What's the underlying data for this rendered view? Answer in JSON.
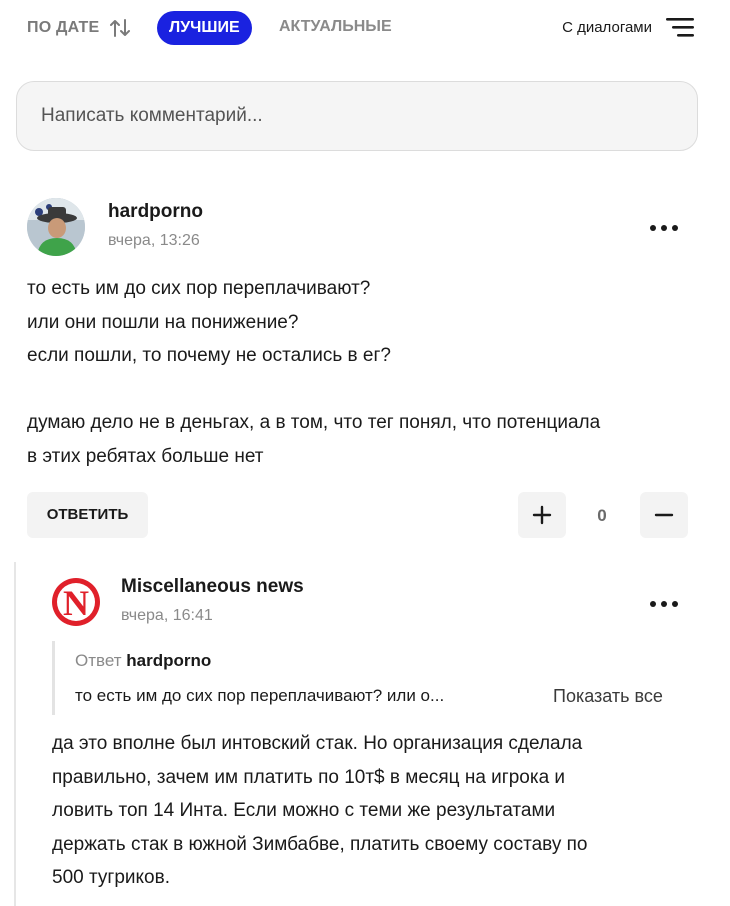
{
  "sortbar": {
    "by_date": "ПО ДАТЕ",
    "best": "ЛУЧШИЕ",
    "actual": "АКТУАЛЬНЫЕ",
    "dialogs": "С диалогами",
    "active_color": "#1a22e0"
  },
  "comment_input": {
    "placeholder": "Написать комментарий..."
  },
  "comment1": {
    "author": "hardporno",
    "time": "вчера, 13:26",
    "lines": [
      "то есть им до сих пор переплачивают?",
      "или они пошли на понижение?",
      "если пошли, то почему не остались в ег?",
      "думаю дело не в деньгах, а в том, что тег понял, что потенциала",
      "в этих ребятах больше нет"
    ],
    "reply_label": "ОТВЕТИТЬ",
    "votes": "0",
    "plus": "+",
    "minus": "−"
  },
  "comment2": {
    "author": "Miscellaneous news",
    "avatar_letter": "N",
    "avatar_color": "#e0202a",
    "time": "вчера, 16:41",
    "quote_prefix": "Ответ",
    "quote_author": "hardporno",
    "quote_text": "то есть им до сих пор переплачивают? или о...",
    "show_all": "Показать все",
    "lines": [
      "да это вполне был интовский стак. Но организация сделала",
      "правильно, зачем им платить по 10т$ в месяц на игрока и",
      "ловить топ 14 Инта. Если можно с теми же результатами",
      "держать стак в южной Зимбабве, платить своему составу по",
      "500 тугриков."
    ]
  }
}
